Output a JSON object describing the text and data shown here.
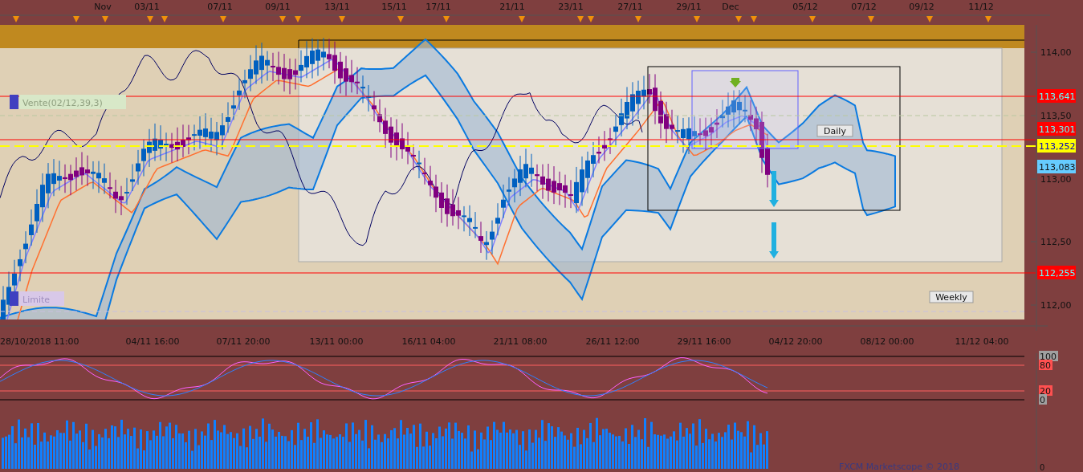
{
  "top_axis": {
    "labels": [
      "Nov",
      "03/11",
      "07/11",
      "09/11",
      "13/11",
      "15/11",
      "17/11",
      "21/11",
      "23/11",
      "27/11",
      "29/11",
      "Dec",
      "05/12",
      "07/12",
      "09/12",
      "11/12"
    ]
  },
  "price_axis": {
    "labels": [
      "114,00",
      "113,50",
      "113,00",
      "112,50",
      "112,00"
    ]
  },
  "price_markers": [
    {
      "label": "113,641",
      "color": "#ff0000"
    },
    {
      "label": "113,301",
      "color": "#ff0000"
    },
    {
      "label": "113,252",
      "color": "#ffff00"
    },
    {
      "label": "113,083",
      "color": "#66ccff"
    },
    {
      "label": "112,255",
      "color": "#ff0000"
    }
  ],
  "orders": [
    {
      "label": "Vente(02/12,39,3)",
      "kind": "sell"
    },
    {
      "label": "Limite",
      "kind": "limit"
    }
  ],
  "annotations": [
    "Daily",
    "Weekly"
  ],
  "time_axis": {
    "labels": [
      "28/10/2018 11:00",
      "04/11 16:00",
      "07/11 20:00",
      "13/11 00:00",
      "16/11 04:00",
      "21/11 08:00",
      "26/11 12:00",
      "29/11 16:00",
      "04/12 20:00",
      "08/12 00:00",
      "11/12 04:00"
    ]
  },
  "oscillator": {
    "levels": [
      {
        "label": "100",
        "color": "#a0a0a0"
      },
      {
        "label": "80",
        "color": "#ff5050"
      },
      {
        "label": "20",
        "color": "#ff5050"
      },
      {
        "label": "0",
        "color": "#a0a0a0"
      }
    ]
  },
  "volume_axis": {
    "label": "0"
  },
  "footer": "FXCM Marketscope © 2018"
}
